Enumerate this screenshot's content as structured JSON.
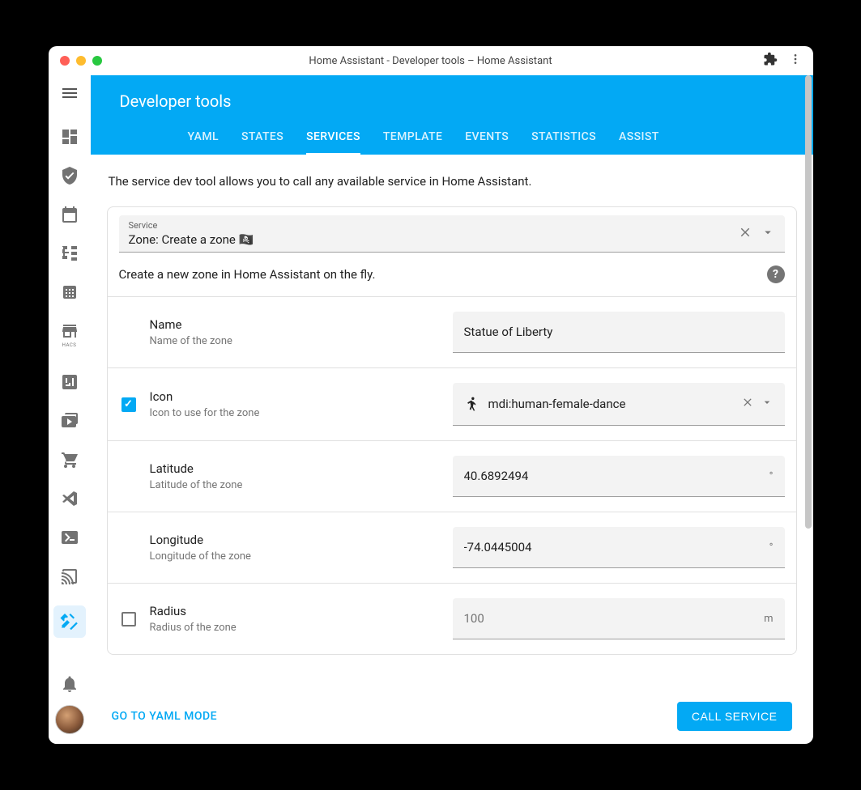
{
  "window_title": "Home Assistant - Developer tools – Home Assistant",
  "header": {
    "title": "Developer tools"
  },
  "tabs": {
    "yaml": "YAML",
    "states": "STATES",
    "services": "SERVICES",
    "template": "TEMPLATE",
    "events": "EVENTS",
    "statistics": "STATISTICS",
    "assist": "ASSIST",
    "active": "services"
  },
  "description": "The service dev tool allows you to call any available service in Home Assistant.",
  "service": {
    "label": "Service",
    "value": "Zone: Create a zone",
    "emoji_name": "pirate-flag",
    "description": "Create a new zone in Home Assistant on the fly."
  },
  "fields": {
    "name": {
      "label": "Name",
      "hint": "Name of the zone",
      "value": "Statue of Liberty",
      "checked": null
    },
    "icon": {
      "label": "Icon",
      "hint": "Icon to use for the zone",
      "value": "mdi:human-female-dance",
      "checked": true
    },
    "latitude": {
      "label": "Latitude",
      "hint": "Latitude of the zone",
      "value": "40.6892494",
      "unit": "°",
      "checked": null
    },
    "longitude": {
      "label": "Longitude",
      "hint": "Longitude of the zone",
      "value": "-74.0445004",
      "unit": "°",
      "checked": null
    },
    "radius": {
      "label": "Radius",
      "hint": "Radius of the zone",
      "placeholder": "100",
      "unit": "m",
      "checked": false
    }
  },
  "footer": {
    "yaml_mode": "GO TO YAML MODE",
    "call_service": "CALL SERVICE"
  },
  "sidebar_hacs": "HACS"
}
